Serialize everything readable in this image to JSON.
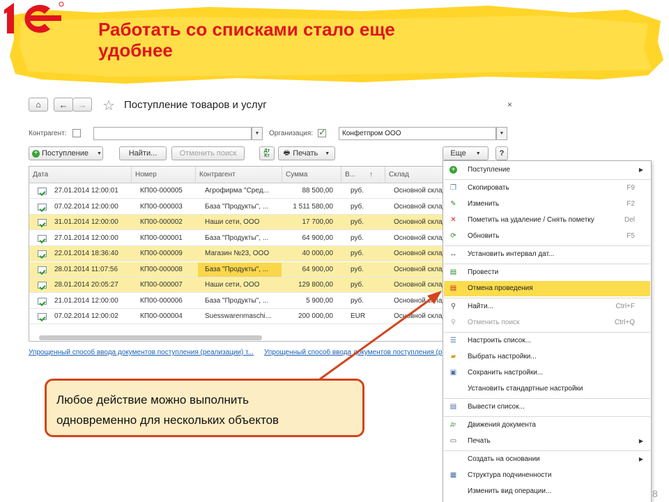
{
  "slide": {
    "title_line1": "Работать со списками стало еще",
    "title_line2": "удобнее",
    "brand_color": "#e0141e",
    "banner_color": "#ffd52a"
  },
  "window": {
    "title": "Поступление товаров и услуг",
    "close": "×"
  },
  "filters": {
    "contractor_label": "Контрагент:",
    "contractor_checked": false,
    "contractor_value": "",
    "organization_label": "Организация:",
    "organization_checked": true,
    "organization_value": "Конфетпром ООО"
  },
  "toolbar": {
    "receipt_button": "Поступление",
    "find_button": "Найти...",
    "cancel_search_button": "Отменить поиск",
    "dtkt_icon": "Дт Кт",
    "print_button": "Печать",
    "more_button": "Еще",
    "help_button": "?"
  },
  "table": {
    "columns": [
      "Дата",
      "Номер",
      "Контрагент",
      "Сумма",
      "В...",
      "Склад"
    ],
    "sort_indicator": "↑",
    "rows": [
      {
        "date": "27.01.2014 12:00:01",
        "number": "КП00-000005",
        "contractor": "Агрофирма \"Сред...",
        "sum": "88 500,00",
        "currency": "руб.",
        "warehouse": "Основной склад",
        "selected": false
      },
      {
        "date": "07.02.2014 12:00:00",
        "number": "КП00-000003",
        "contractor": "База \"Продукты\", ...",
        "sum": "1 511 580,00",
        "currency": "руб.",
        "warehouse": "Основной склад",
        "selected": false
      },
      {
        "date": "31.01.2014 12:00:00",
        "number": "КП00-000002",
        "contractor": "Наши сети, ООО",
        "sum": "17 700,00",
        "currency": "руб.",
        "warehouse": "Основной склад",
        "selected": true
      },
      {
        "date": "27.01.2014 12:00:00",
        "number": "КП00-000001",
        "contractor": "База \"Продукты\", ...",
        "sum": "64 900,00",
        "currency": "руб.",
        "warehouse": "Основной склад",
        "selected": false
      },
      {
        "date": "22.01.2014 18:36:40",
        "number": "КП00-000009",
        "contractor": "Магазин №23, ООО",
        "sum": "40 000,00",
        "currency": "руб.",
        "warehouse": "Основной склад",
        "selected": true
      },
      {
        "date": "28.01.2014 11:07:56",
        "number": "КП00-000008",
        "contractor": "База \"Продукты\", ...",
        "sum": "64 900,00",
        "currency": "руб.",
        "warehouse": "Основной склад",
        "selected": true
      },
      {
        "date": "28.01.2014 20:05:27",
        "number": "КП00-000007",
        "contractor": "Наши сети, ООО",
        "sum": "129 800,00",
        "currency": "руб.",
        "warehouse": "Основной склад",
        "selected": true
      },
      {
        "date": "21.01.2014 12:00:00",
        "number": "КП00-000006",
        "contractor": "База \"Продукты\", ...",
        "sum": "5 900,00",
        "currency": "руб.",
        "warehouse": "Основной склад",
        "selected": false
      },
      {
        "date": "07.02.2014 12:00:02",
        "number": "КП00-000004",
        "contractor": "Suesswarenmaschi...",
        "sum": "200 000,00",
        "currency": "EUR",
        "warehouse": "Основной склад",
        "selected": false
      }
    ]
  },
  "links": {
    "link1": "Упрощенный способ ввода документов поступления (реализации) т...",
    "link2": "Упрощенный способ ввода документов поступления (р"
  },
  "menu": {
    "items": [
      {
        "label": "Поступление",
        "shortcut": "",
        "submenu": true,
        "icon": "add-circle-icon",
        "highlighted": false,
        "disabled": false,
        "sep_after": true
      },
      {
        "label": "Скопировать",
        "shortcut": "F9",
        "submenu": false,
        "icon": "copy-icon",
        "highlighted": false,
        "disabled": false,
        "sep_after": false
      },
      {
        "label": "Изменить",
        "shortcut": "F2",
        "submenu": false,
        "icon": "pencil-icon",
        "highlighted": false,
        "disabled": false,
        "sep_after": false
      },
      {
        "label": "Пометить на удаление / Снять пометку",
        "shortcut": "Del",
        "submenu": false,
        "icon": "delete-mark-icon",
        "highlighted": false,
        "disabled": false,
        "sep_after": false
      },
      {
        "label": "Обновить",
        "shortcut": "F5",
        "submenu": false,
        "icon": "refresh-icon",
        "highlighted": false,
        "disabled": false,
        "sep_after": true
      },
      {
        "label": "Установить интервал дат...",
        "shortcut": "",
        "submenu": false,
        "icon": "date-interval-icon",
        "highlighted": false,
        "disabled": false,
        "sep_after": true
      },
      {
        "label": "Провести",
        "shortcut": "",
        "submenu": false,
        "icon": "post-document-icon",
        "highlighted": false,
        "disabled": false,
        "sep_after": false
      },
      {
        "label": "Отмена проведения",
        "shortcut": "",
        "submenu": false,
        "icon": "unpost-document-icon",
        "highlighted": true,
        "disabled": false,
        "sep_after": true
      },
      {
        "label": "Найти...",
        "shortcut": "Ctrl+F",
        "submenu": false,
        "icon": "search-icon",
        "highlighted": false,
        "disabled": false,
        "sep_after": false
      },
      {
        "label": "Отменить поиск",
        "shortcut": "Ctrl+Q",
        "submenu": false,
        "icon": "cancel-search-icon",
        "highlighted": false,
        "disabled": true,
        "sep_after": true
      },
      {
        "label": "Настроить список...",
        "shortcut": "",
        "submenu": false,
        "icon": "list-settings-icon",
        "highlighted": false,
        "disabled": false,
        "sep_after": false
      },
      {
        "label": "Выбрать настройки...",
        "shortcut": "",
        "submenu": false,
        "icon": "open-folder-icon",
        "highlighted": false,
        "disabled": false,
        "sep_after": false
      },
      {
        "label": "Сохранить настройки...",
        "shortcut": "",
        "submenu": false,
        "icon": "save-icon",
        "highlighted": false,
        "disabled": false,
        "sep_after": false
      },
      {
        "label": "Установить стандартные настройки",
        "shortcut": "",
        "submenu": false,
        "icon": "",
        "highlighted": false,
        "disabled": false,
        "sep_after": true
      },
      {
        "label": "Вывести список...",
        "shortcut": "",
        "submenu": false,
        "icon": "output-list-icon",
        "highlighted": false,
        "disabled": false,
        "sep_after": true
      },
      {
        "label": "Движения документа",
        "shortcut": "",
        "submenu": false,
        "icon": "dt-kt-icon",
        "highlighted": false,
        "disabled": false,
        "sep_after": false
      },
      {
        "label": "Печать",
        "shortcut": "",
        "submenu": true,
        "icon": "printer-icon",
        "highlighted": false,
        "disabled": false,
        "sep_after": true
      },
      {
        "label": "Создать на основании",
        "shortcut": "",
        "submenu": true,
        "icon": "",
        "highlighted": false,
        "disabled": false,
        "sep_after": false
      },
      {
        "label": "Структура подчиненности",
        "shortcut": "",
        "submenu": false,
        "icon": "structure-icon",
        "highlighted": false,
        "disabled": false,
        "sep_after": false
      },
      {
        "label": "Изменить вид операции...",
        "shortcut": "",
        "submenu": false,
        "icon": "",
        "highlighted": false,
        "disabled": false,
        "sep_after": false
      }
    ]
  },
  "callout": {
    "line1": "Любое действие можно выполнить",
    "line2": "одновременно  для  нескольких  объектов",
    "border_color": "#d2451e",
    "fill_color": "#fdedc4"
  },
  "page_number": "8"
}
